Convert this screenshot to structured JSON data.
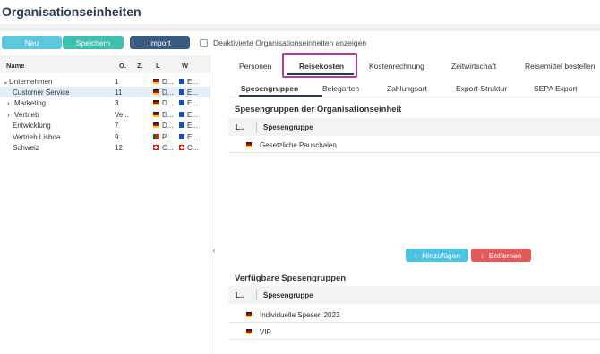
{
  "header": {
    "title": "Organisationseinheiten"
  },
  "toolbar": {
    "new_label": "Neu",
    "save_label": "Speichern",
    "import_label": "Import",
    "show_inactive_label": "Deaktivierte Organisationseinheiten anzeigen"
  },
  "tree": {
    "columns": [
      "Name",
      "O.",
      "Z.",
      "L",
      "W"
    ],
    "rows": [
      {
        "name": "Unternehmen",
        "o": "1",
        "l": "D...",
        "w": "E..."
      },
      {
        "name": "Customer Service",
        "o": "11",
        "l": "D...",
        "w": "E..."
      },
      {
        "name": "Marketing",
        "o": "3",
        "l": "D...",
        "w": "E..."
      },
      {
        "name": "Vertrieb",
        "o": "Ve...",
        "l": "D...",
        "w": "E..."
      },
      {
        "name": "Entwicklung",
        "o": "7",
        "l": "D...",
        "w": "E..."
      },
      {
        "name": "Vertrieb Lisboa",
        "o": "9",
        "l": "P...",
        "w": "E..."
      },
      {
        "name": "Schweiz",
        "o": "12",
        "l": "C...",
        "w": "C..."
      }
    ]
  },
  "tabs": [
    "Personen",
    "Reisekosten",
    "Kostenrechnung",
    "Zeitwirtschaft",
    "Reisemittel bestellen"
  ],
  "subtabs": [
    "Spesengruppen",
    "Belegarten",
    "Zahlungsart",
    "Export-Struktur",
    "SEPA Export"
  ],
  "assigned": {
    "title": "Spesengruppen der Organisationseinheit",
    "col_l": "L..",
    "col_group": "Spesengruppe",
    "rows": [
      "Gesetzliche Pauschalen"
    ]
  },
  "actions": {
    "add_label": "Hinzufügen",
    "remove_label": "Entfernen"
  },
  "available": {
    "title": "Verfügbare Spesengruppen",
    "col_l": "L..",
    "col_group": "Spesengruppe",
    "rows": [
      "Individuelle Spesen 2023",
      "VIP"
    ]
  },
  "colors": {
    "teal": "#3ebfb0",
    "navy": "#3b5a82",
    "sky": "#5bc8de",
    "blue_light": "#4cc3e0",
    "red": "#e45a5a",
    "highlight": "#b03aa0"
  }
}
